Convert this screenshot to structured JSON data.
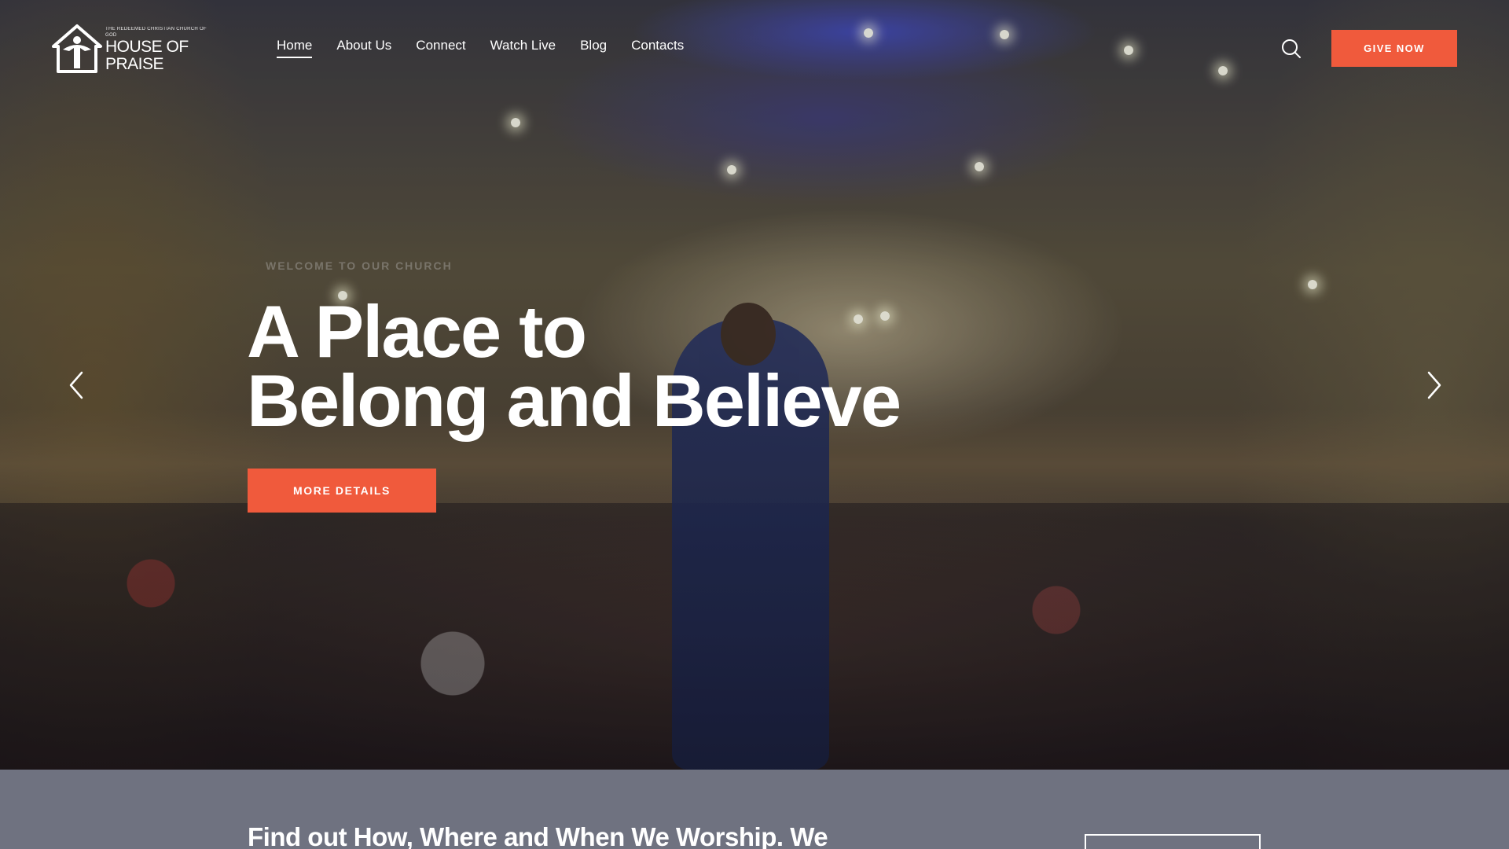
{
  "brand": {
    "name": "HOUSE OF PRAISE",
    "tagline": "THE REDEEMED CHRISTIAN CHURCH OF GOD"
  },
  "nav": {
    "items": [
      {
        "label": "Home",
        "active": true
      },
      {
        "label": "About Us",
        "active": false
      },
      {
        "label": "Connect",
        "active": false
      },
      {
        "label": "Watch Live",
        "active": false
      },
      {
        "label": "Blog",
        "active": false
      },
      {
        "label": "Contacts",
        "active": false
      }
    ]
  },
  "header": {
    "search_icon": "search-icon",
    "give_label": "GIVE NOW"
  },
  "hero": {
    "eyebrow": "WELCOME TO OUR CHURCH",
    "headline_line1": "A Place to",
    "headline_line2": "Belong and Believe",
    "cta_label": "MORE DETAILS",
    "prev_icon": "chevron-left-icon",
    "next_icon": "chevron-right-icon"
  },
  "lower": {
    "heading": "Find out How, Where and When We Worship. We"
  },
  "colors": {
    "accent": "#f05a3c",
    "strip": "#6f7280",
    "text": "#ffffff"
  }
}
